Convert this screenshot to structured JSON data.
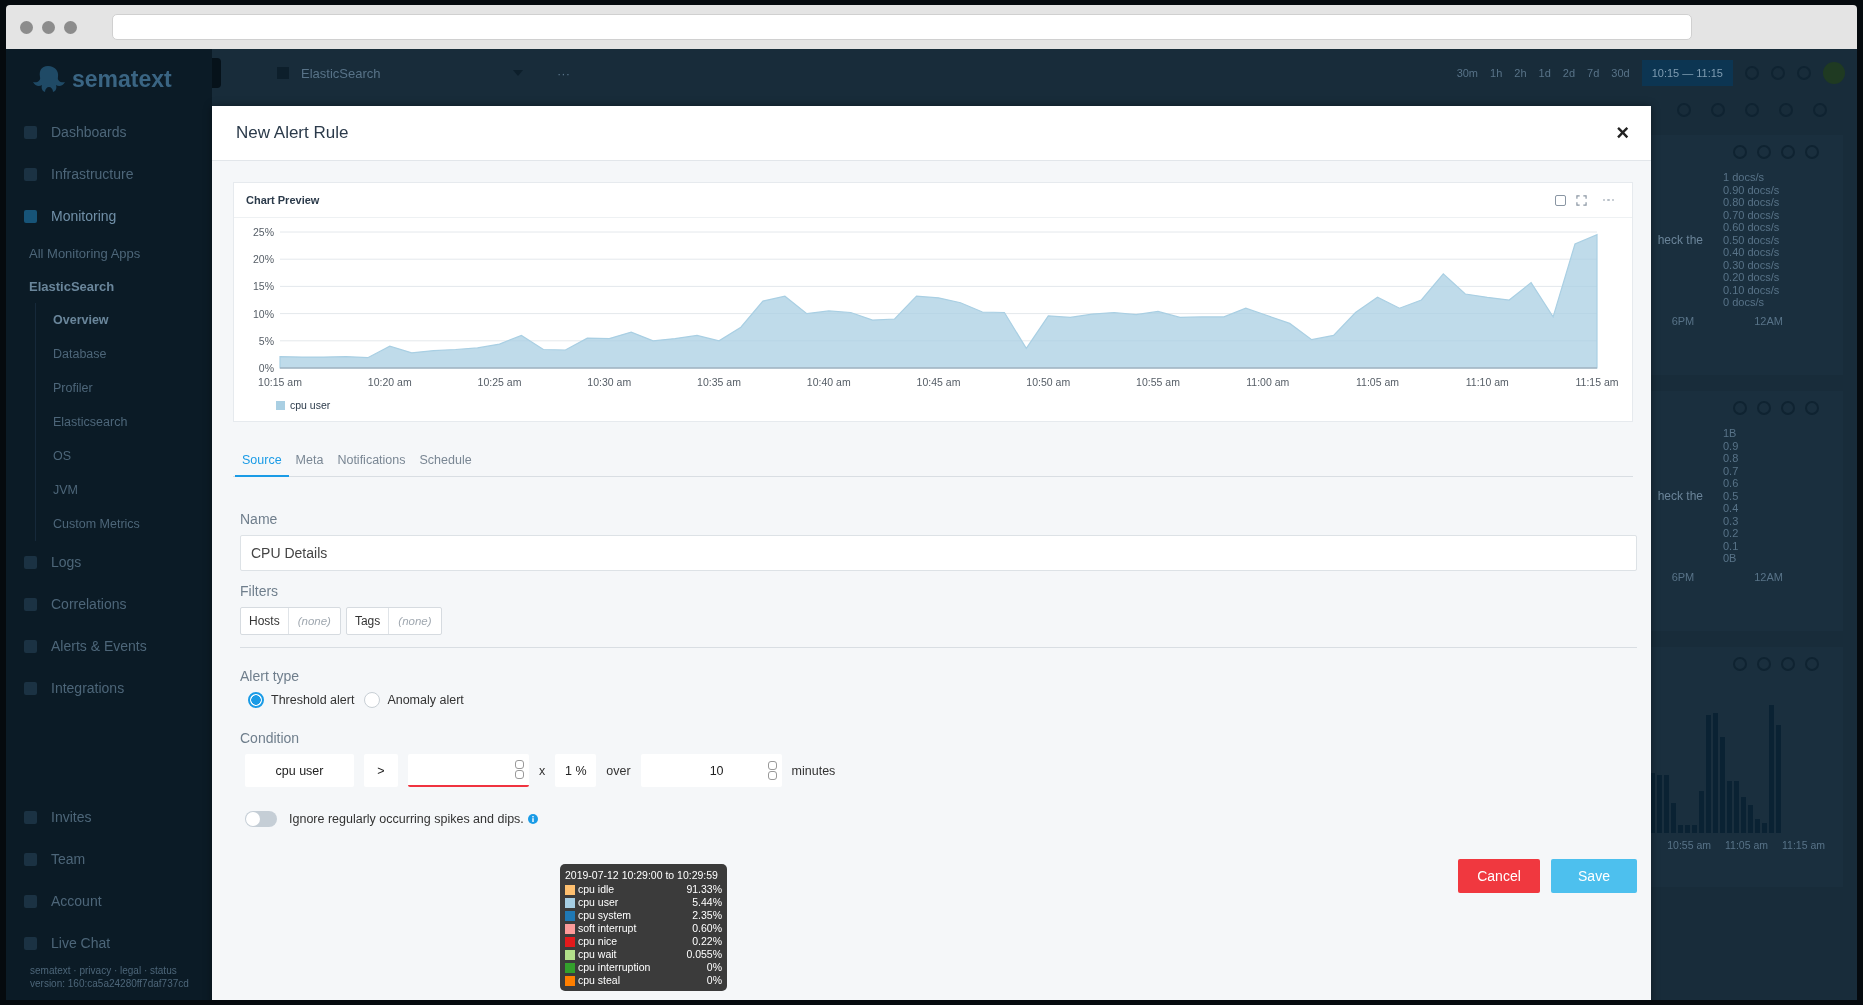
{
  "sidebar": {
    "logo": "sematext",
    "nav": [
      {
        "label": "Dashboards",
        "selected": false
      },
      {
        "label": "Infrastructure",
        "selected": false
      },
      {
        "label": "Monitoring",
        "selected": true,
        "children": [
          {
            "label": "All Monitoring Apps",
            "selected": false
          },
          {
            "label": "ElasticSearch",
            "selected": true,
            "children": [
              {
                "label": "Overview",
                "selected": true
              },
              {
                "label": "Database",
                "selected": false
              },
              {
                "label": "Profiler",
                "selected": false
              },
              {
                "label": "Elasticsearch",
                "selected": false
              },
              {
                "label": "OS",
                "selected": false
              },
              {
                "label": "JVM",
                "selected": false
              },
              {
                "label": "Custom Metrics",
                "selected": false
              }
            ]
          }
        ]
      },
      {
        "label": "Logs",
        "selected": false
      },
      {
        "label": "Correlations",
        "selected": false
      },
      {
        "label": "Alerts & Events",
        "selected": false
      },
      {
        "label": "Integrations",
        "selected": false
      }
    ],
    "bottom_nav": [
      "Invites",
      "Team",
      "Account",
      "Live Chat"
    ],
    "footer": "sematext · privacy · legal · status",
    "version": "version: 160:ca5a24280ff7daf737cd"
  },
  "topbar": {
    "app": "ElasticSearch",
    "more": "···",
    "ranges": [
      {
        "label": "30m",
        "selected": false
      },
      {
        "label": "1h",
        "selected": false
      },
      {
        "label": "2h",
        "selected": false
      },
      {
        "label": "1d",
        "selected": false
      },
      {
        "label": "2d",
        "selected": false
      },
      {
        "label": "7d",
        "selected": false
      },
      {
        "label": "30d",
        "selected": false
      }
    ],
    "time": "10:15 — 11:15"
  },
  "background_panels": [
    {
      "kind": "line",
      "text": "heck the",
      "y_ticks": [
        "1 docs/s",
        "0.90 docs/s",
        "0.80 docs/s",
        "0.70 docs/s",
        "0.60 docs/s",
        "0.50 docs/s",
        "0.40 docs/s",
        "0.30 docs/s",
        "0.20 docs/s",
        "0.10 docs/s",
        "0 docs/s"
      ],
      "x_ticks": [
        "6PM",
        "12AM"
      ]
    },
    {
      "kind": "line",
      "text": "heck the",
      "y_ticks": [
        "1B",
        "0.9",
        "0.8",
        "0.7",
        "0.6",
        "0.5",
        "0.4",
        "0.3",
        "0.2",
        "0.1",
        "0B"
      ],
      "x_ticks": [
        "6PM",
        "12AM"
      ]
    },
    {
      "kind": "bars",
      "x_ticks": [
        "10:55 am",
        "11:05 am",
        "11:15 am"
      ]
    }
  ],
  "modal": {
    "title": "New Alert Rule",
    "close": "×",
    "chart": {
      "title": "Chart Preview",
      "chart_data": {
        "type": "area",
        "categories": [
          "10:15 am",
          null,
          null,
          null,
          null,
          "10:20 am",
          null,
          null,
          null,
          null,
          "10:25 am",
          null,
          null,
          null,
          null,
          "10:30 am",
          null,
          null,
          null,
          null,
          "10:35 am",
          null,
          null,
          null,
          null,
          "10:40 am",
          null,
          null,
          null,
          null,
          "10:45 am",
          null,
          null,
          null,
          null,
          "10:50 am",
          null,
          null,
          null,
          null,
          "10:55 am",
          null,
          null,
          null,
          null,
          "11:00 am",
          null,
          null,
          null,
          null,
          "11:05 am",
          null,
          null,
          null,
          null,
          "11:10 am",
          null,
          null,
          null,
          null,
          "11:15 am"
        ],
        "series": [
          {
            "name": "cpu user",
            "color": "#a9cfe3",
            "values": [
              2.1,
              2.0,
              2.0,
              2.1,
              1.9,
              4.0,
              2.8,
              3.2,
              3.4,
              3.7,
              4.4,
              6.0,
              3.4,
              3.3,
              5.5,
              5.4,
              6.6,
              5.0,
              5.4,
              6.0,
              5.0,
              7.5,
              12.3,
              13.2,
              10.0,
              10.5,
              10.2,
              8.8,
              9.0,
              13.2,
              12.9,
              12.0,
              10.3,
              10.2,
              3.6,
              9.6,
              9.3,
              9.9,
              10.2,
              9.8,
              10.4,
              9.3,
              9.4,
              9.4,
              11.0,
              9.6,
              8.2,
              5.2,
              6.0,
              10.2,
              13.0,
              11.0,
              12.5,
              17.3,
              13.6,
              13.0,
              12.5,
              15.7,
              9.4,
              22.8,
              24.5
            ]
          }
        ],
        "ylim": [
          0,
          25
        ],
        "grid": true,
        "yticks": [
          {
            "value": 0,
            "label": "0%"
          },
          {
            "value": 5,
            "label": "5%"
          },
          {
            "value": 10,
            "label": "10%"
          },
          {
            "value": 15,
            "label": "15%"
          },
          {
            "value": 20,
            "label": "20%"
          },
          {
            "value": 25,
            "label": "25%"
          }
        ]
      }
    },
    "tabs": [
      {
        "label": "Source",
        "selected": true
      },
      {
        "label": "Meta",
        "selected": false
      },
      {
        "label": "Notifications",
        "selected": false
      },
      {
        "label": "Schedule",
        "selected": false
      }
    ],
    "name": {
      "label": "Name",
      "value": "CPU Details"
    },
    "filters": {
      "label": "Filters",
      "items": [
        {
          "label": "Hosts",
          "value": "(none)"
        },
        {
          "label": "Tags",
          "value": "(none)"
        }
      ]
    },
    "alert_type": {
      "label": "Alert type",
      "options": [
        {
          "label": "Threshold alert",
          "selected": true
        },
        {
          "label": "Anomaly alert",
          "selected": false
        }
      ]
    },
    "condition": {
      "label": "Condition",
      "metric": "cpu user",
      "operator": ">",
      "threshold_error": true,
      "times": "x",
      "percent": "1 %",
      "over": "over",
      "minutes_value": "10",
      "unit": "minutes"
    },
    "ignore": {
      "label": "Ignore regularly occurring spikes and dips.",
      "on": false
    },
    "buttons": [
      {
        "label": "Cancel",
        "kind": "cancel"
      },
      {
        "label": "Save",
        "kind": "save"
      }
    ],
    "tooltip": {
      "title": "2019-07-12 10:29:00 to 10:29:59",
      "rows": [
        {
          "label": "cpu idle",
          "value": "91.33%",
          "color": "#fdbf6f"
        },
        {
          "label": "cpu user",
          "value": "5.44%",
          "color": "#a6cee3"
        },
        {
          "label": "cpu system",
          "value": "2.35%",
          "color": "#1f78b4"
        },
        {
          "label": "soft interrupt",
          "value": "0.60%",
          "color": "#fb9a99"
        },
        {
          "label": "cpu nice",
          "value": "0.22%",
          "color": "#e31a1c"
        },
        {
          "label": "cpu wait",
          "value": "0.055%",
          "color": "#b2df8a"
        },
        {
          "label": "cpu interruption",
          "value": "0%",
          "color": "#33a02c"
        },
        {
          "label": "cpu steal",
          "value": "0%",
          "color": "#ff7f00"
        }
      ]
    }
  }
}
